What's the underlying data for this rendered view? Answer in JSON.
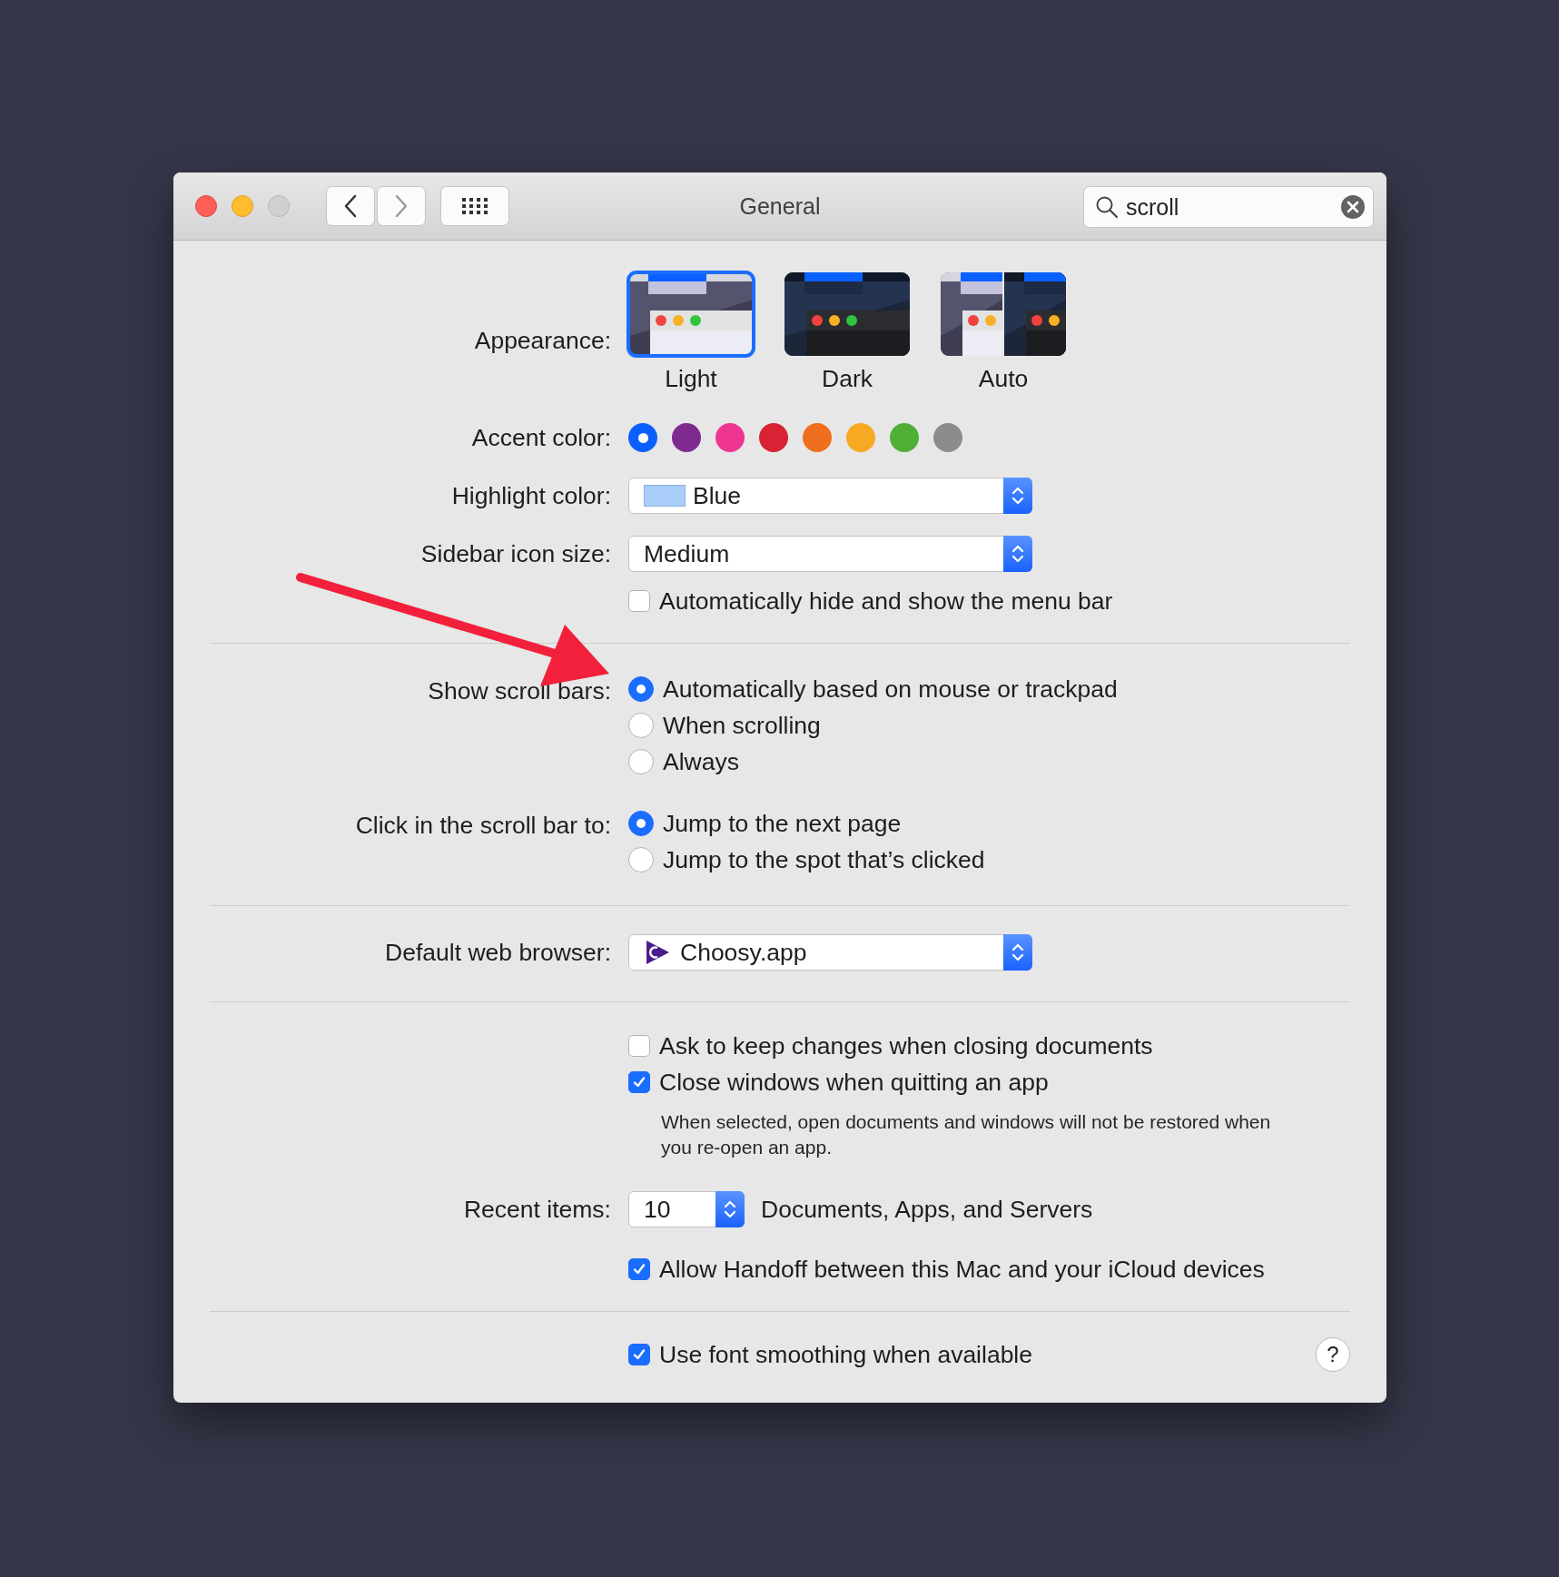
{
  "window": {
    "title": "General",
    "search": {
      "value": "scroll"
    }
  },
  "appearance": {
    "label": "Appearance:",
    "options": [
      {
        "label": "Light",
        "kind": "light",
        "selected": true
      },
      {
        "label": "Dark",
        "kind": "dark",
        "selected": false
      },
      {
        "label": "Auto",
        "kind": "auto",
        "selected": false
      }
    ]
  },
  "accent_color": {
    "label": "Accent color:",
    "colors": [
      {
        "color": "#0a60ff",
        "selected": true
      },
      {
        "color": "#7f2a8e",
        "selected": false
      },
      {
        "color": "#ef3592",
        "selected": false
      },
      {
        "color": "#d72334",
        "selected": false
      },
      {
        "color": "#f06f1e",
        "selected": false
      },
      {
        "color": "#f8a922",
        "selected": false
      },
      {
        "color": "#4faf37",
        "selected": false
      },
      {
        "color": "#8c8c8c",
        "selected": false
      }
    ]
  },
  "highlight_color": {
    "label": "Highlight color:",
    "value": "Blue",
    "color": "#a8cdf8"
  },
  "sidebar_icon_size": {
    "label": "Sidebar icon size:",
    "value": "Medium"
  },
  "menu_bar": {
    "label": "Automatically hide and show the menu bar",
    "checked": false
  },
  "show_scroll_bars": {
    "label": "Show scroll bars:",
    "options": [
      {
        "label": "Automatically based on mouse or trackpad",
        "selected": true
      },
      {
        "label": "When scrolling",
        "selected": false
      },
      {
        "label": "Always",
        "selected": false
      }
    ]
  },
  "click_scroll_bar": {
    "label": "Click in the scroll bar to:",
    "options": [
      {
        "label": "Jump to the next page",
        "selected": true
      },
      {
        "label": "Jump to the spot that’s clicked",
        "selected": false
      }
    ]
  },
  "default_browser": {
    "label": "Default web browser:",
    "value": "Choosy.app"
  },
  "documents": [
    {
      "label": "Ask to keep changes when closing documents",
      "checked": false
    },
    {
      "label": "Close windows when quitting an app",
      "checked": true,
      "note": "When selected, open documents and windows will not be restored when you re-open an app."
    }
  ],
  "recent_items": {
    "label": "Recent items:",
    "value": "10",
    "suffix": "Documents, Apps, and Servers"
  },
  "handoff": {
    "label": "Allow Handoff between this Mac and your iCloud devices",
    "checked": true
  },
  "font_smoothing": {
    "label": "Use font smoothing when available",
    "checked": true
  },
  "help_button": {
    "label": "?"
  }
}
